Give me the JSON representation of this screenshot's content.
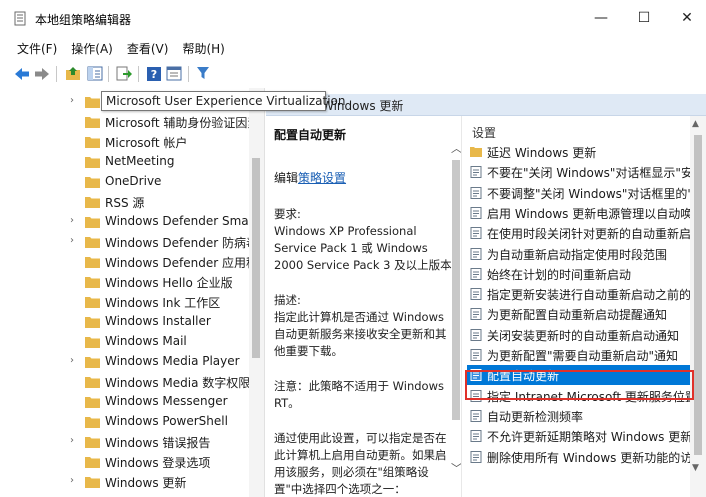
{
  "window": {
    "title": "本地组策略编辑器",
    "minimize": "—",
    "maximize": "☐",
    "close": "✕"
  },
  "menu": [
    "文件(F)",
    "操作(A)",
    "查看(V)",
    "帮助(H)"
  ],
  "toolbar_icons": [
    "back-icon",
    "forward-icon",
    "up-folder-icon",
    "show-hide-tree-icon",
    "export-list-icon",
    "help-icon",
    "properties-icon",
    "filter-icon"
  ],
  "tree": {
    "items": [
      {
        "label": "Microsoft User Experience Virtualization",
        "expandable": true
      },
      {
        "label": "Microsoft 辅助身份验证因素",
        "expandable": false
      },
      {
        "label": "Microsoft 帐户",
        "expandable": false
      },
      {
        "label": "NetMeeting",
        "expandable": false
      },
      {
        "label": "OneDrive",
        "expandable": false
      },
      {
        "label": "RSS 源",
        "expandable": false
      },
      {
        "label": "Windows Defender SmartScreen",
        "expandable": true
      },
      {
        "label": "Windows Defender 防病毒程序",
        "expandable": true
      },
      {
        "label": "Windows Defender 应用程序防护",
        "expandable": false
      },
      {
        "label": "Windows Hello 企业版",
        "expandable": false
      },
      {
        "label": "Windows Ink 工作区",
        "expandable": false
      },
      {
        "label": "Windows Installer",
        "expandable": false
      },
      {
        "label": "Windows Mail",
        "expandable": false
      },
      {
        "label": "Windows Media Player",
        "expandable": true
      },
      {
        "label": "Windows Media 数字权限管理",
        "expandable": false
      },
      {
        "label": "Windows Messenger",
        "expandable": false
      },
      {
        "label": "Windows PowerShell",
        "expandable": false
      },
      {
        "label": "Windows 错误报告",
        "expandable": true
      },
      {
        "label": "Windows 登录选项",
        "expandable": false
      },
      {
        "label": "Windows 更新",
        "expandable": true
      }
    ],
    "tooltip": "Microsoft User Experience Virtualization"
  },
  "header": {
    "text": "Windows 更新"
  },
  "description": {
    "title": "配置自动更新",
    "edit_prefix": "编辑",
    "edit_link": "策略设置",
    "requirements_label": "要求:",
    "requirements_text": "Windows XP Professional Service Pack 1 或 Windows 2000 Service Pack 3 及以上版本",
    "desc_label": "描述:",
    "desc_text": "指定此计算机是否通过 Windows 自动更新服务来接收安全更新和其他重要下载。",
    "note_text": "注意：此策略不适用于 Windows RT。",
    "usage_text": "通过使用此设置，可以指定是否在此计算机上启用自动更新。如果启用该服务，则必须在\"组策略设置\"中选择四个选项之一："
  },
  "list": {
    "header": "设置",
    "items": [
      {
        "label": "延迟 Windows 更新",
        "type": "folder"
      },
      {
        "label": "不要在\"关闭 Windows\"对话框显示\"安装更新并关机\"",
        "type": "setting"
      },
      {
        "label": "不要调整\"关闭 Windows\"对话框里的\"安装更新并关机\"",
        "type": "setting"
      },
      {
        "label": "启用 Windows 更新电源管理以自动唤醒系统",
        "type": "setting"
      },
      {
        "label": "在使用时段关闭针对更新的自动重新启动",
        "type": "setting"
      },
      {
        "label": "为自动重新启动指定使用时段范围",
        "type": "setting"
      },
      {
        "label": "始终在计划的时间重新启动",
        "type": "setting"
      },
      {
        "label": "指定更新安装进行自动重新启动之前的最后期限",
        "type": "setting"
      },
      {
        "label": "为更新配置自动重新启动提醒通知",
        "type": "setting"
      },
      {
        "label": "关闭安装更新时的自动重新启动通知",
        "type": "setting"
      },
      {
        "label": "为更新配置\"需要自动重新启动\"通知",
        "type": "setting"
      },
      {
        "label": "配置自动更新",
        "type": "setting",
        "selected": true
      },
      {
        "label": "指定 Intranet Microsoft 更新服务位置",
        "type": "setting"
      },
      {
        "label": "自动更新检测频率",
        "type": "setting"
      },
      {
        "label": "不允许更新延期策略对 Windows 更新执行扫描",
        "type": "setting"
      },
      {
        "label": "删除使用所有 Windows 更新功能的访问权限",
        "type": "setting"
      }
    ]
  },
  "colors": {
    "selection": "#0078d7",
    "highlight_box": "#e0312a",
    "header_strip": "#dfe9f5",
    "link": "#1a5fb4",
    "folder": "#e8b84a"
  }
}
